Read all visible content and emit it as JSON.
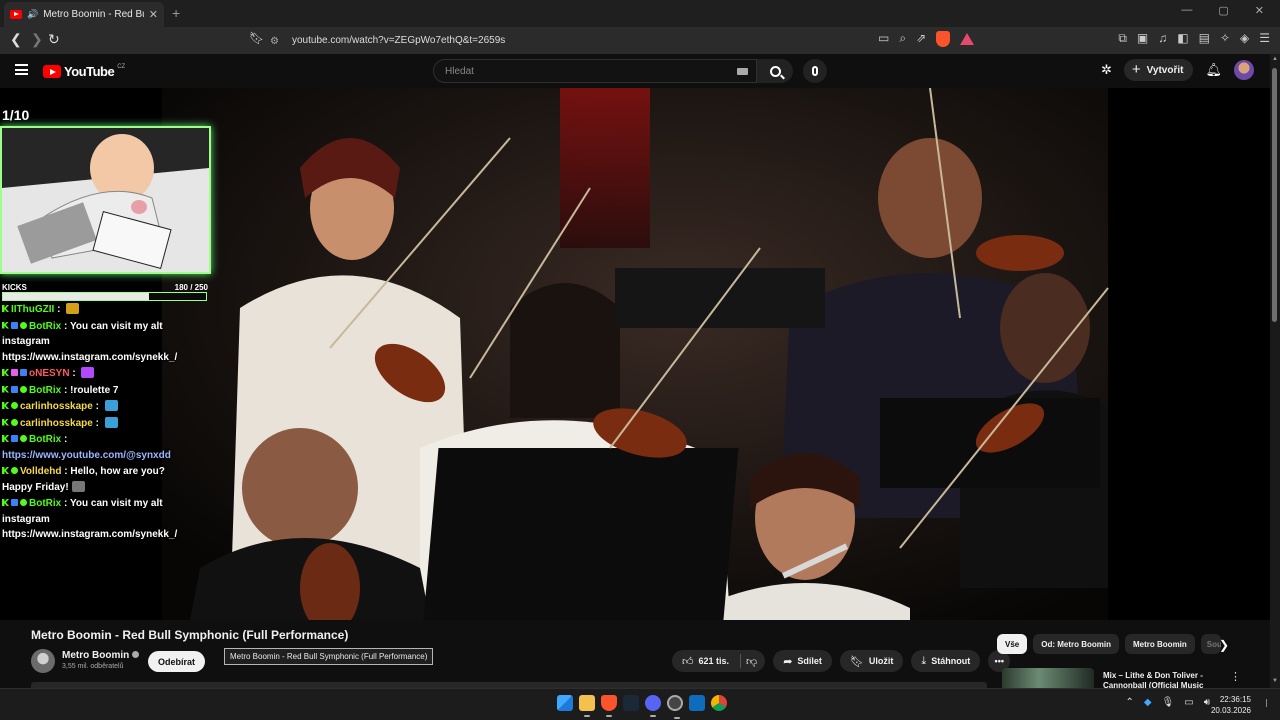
{
  "browser": {
    "tab_title": "Metro Boomin - Red Bull Symp",
    "new_tab": "+",
    "window_controls": [
      "—",
      "▢",
      "✕"
    ],
    "url": "youtube.com/watch?v=ZEGpWo7ethQ&t=2659s"
  },
  "youtube": {
    "logo_text": "YouTube",
    "country": "CZ",
    "search_placeholder": "Hledat",
    "create_label": "Vytvořit"
  },
  "overlay": {
    "counter": "1/10",
    "kicks_label": "KICKS",
    "kicks_value": "180 / 250",
    "kicks_fraction": 0.72,
    "chat": [
      {
        "user": "IIThuGZII",
        "user_color": "#53fc18",
        "badges": [
          "k"
        ],
        "text": "",
        "emote": "#d4a017"
      },
      {
        "user": "BotRix",
        "user_color": "#53fc18",
        "badges": [
          "k",
          "b",
          "v"
        ],
        "text": "You can visit my alt instagram https://www.instagram.com/synekk_/"
      },
      {
        "user": "oNESYN",
        "user_color": "#ff5a5a",
        "badges": [
          "k",
          "p",
          "b"
        ],
        "text": "",
        "emote": "#b349ff"
      },
      {
        "user": "BotRix",
        "user_color": "#53fc18",
        "badges": [
          "k",
          "b",
          "v"
        ],
        "text": "!roulette 7"
      },
      {
        "user": "carlinhosskape",
        "user_color": "#f6d94a",
        "badges": [
          "k",
          "v"
        ],
        "text": "",
        "emote": "#3aa0d8"
      },
      {
        "user": "carlinhosskape",
        "user_color": "#f6d94a",
        "badges": [
          "k",
          "v"
        ],
        "text": "",
        "emote": "#3aa0d8"
      },
      {
        "user": "BotRix",
        "user_color": "#53fc18",
        "badges": [
          "k",
          "b",
          "v"
        ],
        "text": "",
        "link": "https://www.youtube.com/@synxdd"
      },
      {
        "user": "Volldehd",
        "user_color": "#f6d94a",
        "badges": [
          "k",
          "v"
        ],
        "text": "Hello, how are you? Happy Friday!",
        "emote": "#777777"
      },
      {
        "user": "BotRix",
        "user_color": "#53fc18",
        "badges": [
          "k",
          "b",
          "v"
        ],
        "text": "You can visit my alt instagram https://www.instagram.com/synekk_/"
      }
    ]
  },
  "video": {
    "title": "Metro Boomin - Red Bull Symphonic (Full Performance)",
    "channel": "Metro Boomin",
    "subscribers": "3,55 mil. odběratelů",
    "subscribe_label": "Odebírat",
    "tooltip": "Metro Boomin - Red Bull Symphonic (Full Performance)",
    "likes": "621 tis.",
    "share_label": "Sdílet",
    "save_label": "Uložit",
    "download_label": "Stáhnout"
  },
  "sidebar": {
    "chips": [
      "Vše",
      "Od: Metro Boomin",
      "Metro Boomin",
      "Sou"
    ],
    "rec_title": "Mix – Lithe & Don Toliver - Cannonball (Official Music"
  },
  "taskbar": {
    "time": "22:36:15",
    "date": "20.03.2026"
  },
  "colors": {
    "youtube_red": "#ff0000",
    "kick_green": "#53fc18",
    "brave_orange": "#fb542b"
  },
  "icons": [
    "back-icon",
    "forward-icon",
    "reload-icon",
    "bookmark-icon",
    "brave-shield-icon",
    "menu-icon",
    "search-icon",
    "mic-icon",
    "create-icon",
    "bell-icon",
    "like-icon",
    "dislike-icon",
    "share-icon",
    "save-icon",
    "download-icon",
    "more-icon"
  ]
}
